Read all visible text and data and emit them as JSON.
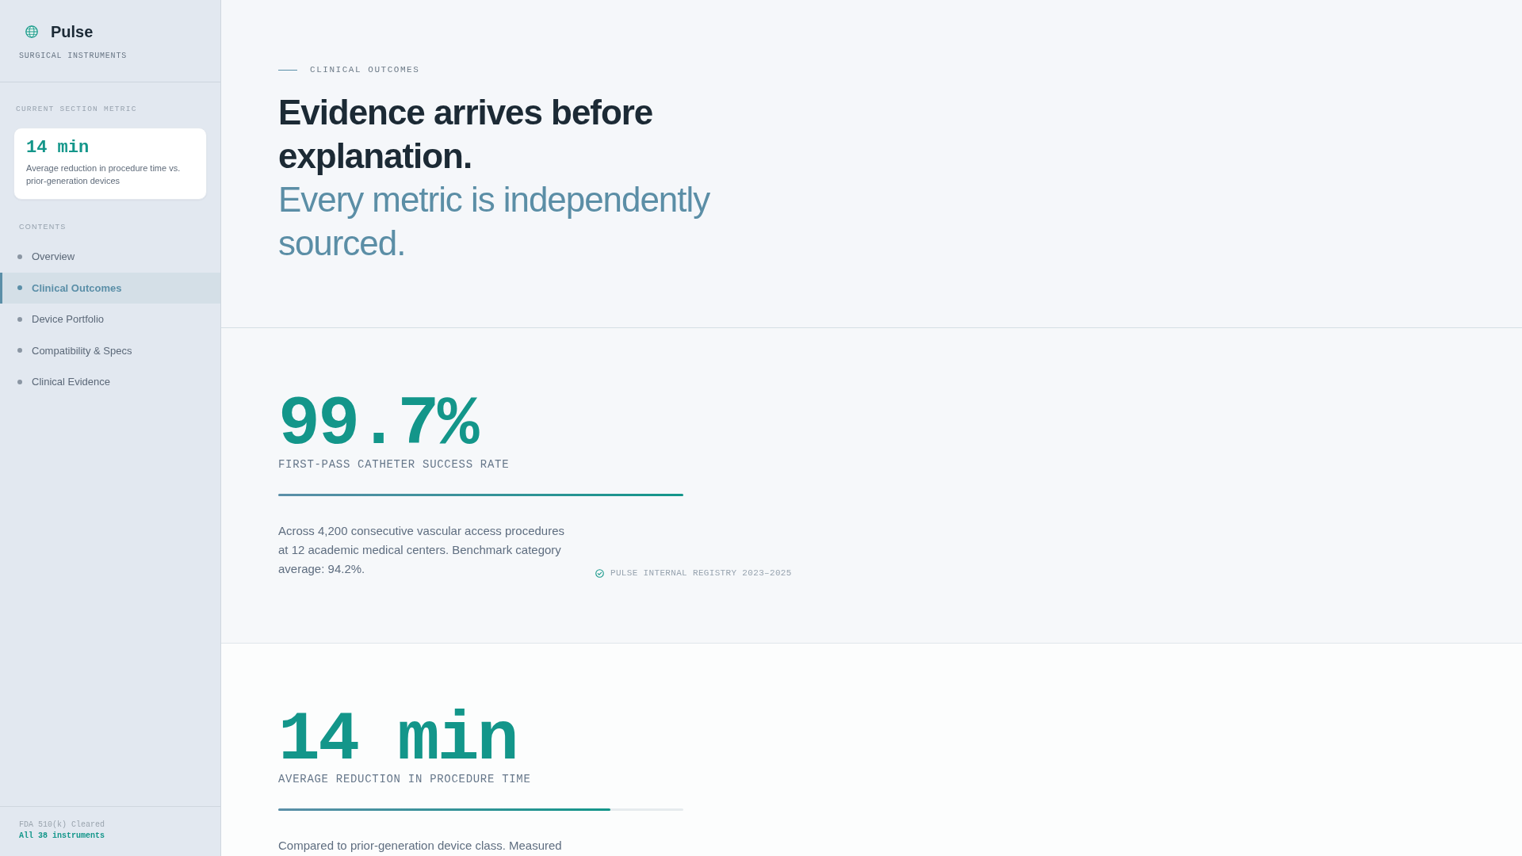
{
  "sidebar": {
    "brand": {
      "name": "Pulse",
      "tagline": "SURGICAL INSTRUMENTS"
    },
    "metric_label": "CURRENT SECTION METRIC",
    "metric_card": {
      "value": "14 min",
      "description": "Average reduction in procedure time vs. prior-generation devices"
    },
    "contents_label": "CONTENTS",
    "nav_items": [
      {
        "label": "Overview",
        "selected": false
      },
      {
        "label": "Clinical Outcomes",
        "selected": true
      },
      {
        "label": "Device Portfolio",
        "selected": false
      },
      {
        "label": "Compatibility & Specs",
        "selected": false
      },
      {
        "label": "Clinical Evidence",
        "selected": false
      }
    ],
    "footer": {
      "status": "FDA 510(k) Cleared",
      "count": "All 38 instruments"
    }
  },
  "header": {
    "eyebrow": "CLINICAL OUTCOMES",
    "title": "Evidence arrives before explanation.",
    "subtitle": "Every metric is independently sourced."
  },
  "metrics": [
    {
      "value": "99.7%",
      "label": "FIRST-PASS CATHETER SUCCESS RATE",
      "level": 1,
      "description": "Across 4,200 consecutive vascular access procedures at 12 academic medical centers. Benchmark category average: 94.2%.",
      "source": "PULSE INTERNAL REGISTRY 2023–2025"
    },
    {
      "value": "14 min",
      "label": "AVERAGE REDUCTION IN PROCEDURE TIME",
      "level": 0.82,
      "description": "Compared to prior-generation device class. Measured"
    }
  ]
}
